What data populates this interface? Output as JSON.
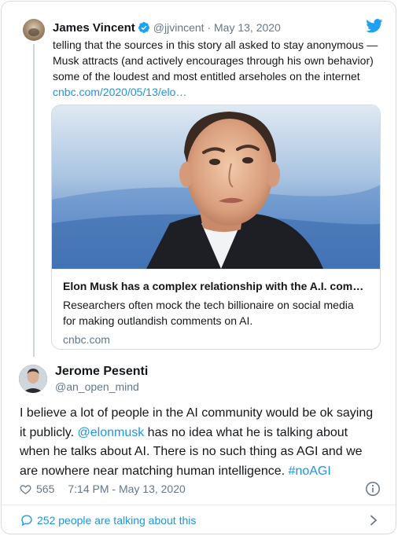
{
  "parent_tweet": {
    "author_name": "James Vincent",
    "handle_date": "@jjvincent · May 13, 2020",
    "text_lines": [
      "telling that the sources in this story all asked to stay anonymous —",
      "Musk attracts (and actively encourages through his own behavior)",
      "some of the loudest and most entitled arseholes on the internet"
    ],
    "link": "cnbc.com/2020/05/13/elo…",
    "icons": [
      "verified-badge-icon",
      "twitter-bird-icon"
    ],
    "link_card": {
      "title": "Elon Musk has a complex relationship with the A.I. com…",
      "description_lines": [
        "Researchers often mock the tech billionaire on social media",
        "for making outlandish comments on AI."
      ],
      "domain": "cnbc.com"
    }
  },
  "main_tweet": {
    "author_name": "Jerome Pesenti",
    "handle": "@an_open_mind",
    "text_lines": [
      [
        {
          "t": "I believe a lot of people in the AI community would be ok saying"
        }
      ],
      [
        {
          "t": "it publicly. "
        },
        {
          "t": "@elonmusk",
          "link": true
        },
        {
          "t": " has no idea what he is talking about"
        }
      ],
      [
        {
          "t": "when he talks about AI. There is no such thing as AGI and we"
        }
      ],
      [
        {
          "t": "are nowhere near matching human intelligence. "
        },
        {
          "t": "#noAGI",
          "link": true
        }
      ]
    ],
    "likes": "565",
    "timestamp": "7:14 PM - May 13, 2020"
  },
  "footer": {
    "conversation": "252 people are talking about this"
  },
  "colors": {
    "link": "#1b95e0",
    "secondary_text": "#657786",
    "border": "#d4dbe1"
  }
}
